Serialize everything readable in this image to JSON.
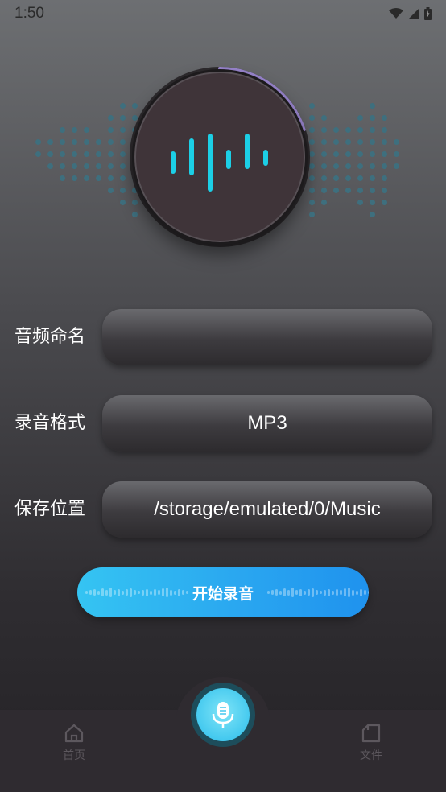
{
  "status_bar": {
    "time": "1:50",
    "icons": [
      "wifi-icon",
      "cellular-icon",
      "battery-icon"
    ]
  },
  "recorder": {
    "progress": 0.2,
    "accent_color": "#9a86cf",
    "bar_color": "#1ccfe6"
  },
  "form": {
    "name_label": "音频命名",
    "name_value": "",
    "format_label": "录音格式",
    "format_value": "MP3",
    "location_label": "保存位置",
    "location_value": "/storage/emulated/0/Music"
  },
  "start_button": {
    "label": "开始录音"
  },
  "tab_bar": {
    "home_label": "首页",
    "home_icon": "home-icon",
    "record_icon": "microphone-icon",
    "files_label": "文件",
    "files_icon": "file-icon"
  }
}
